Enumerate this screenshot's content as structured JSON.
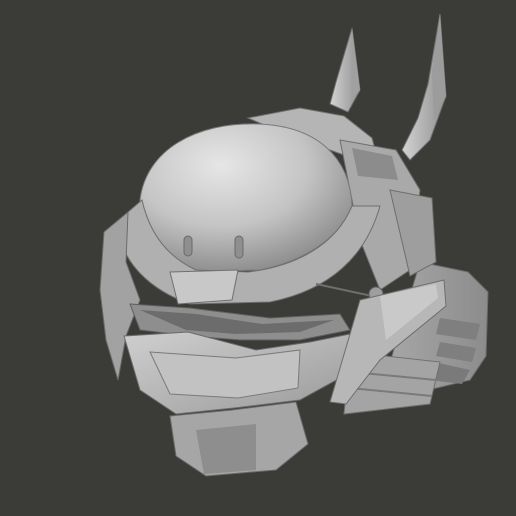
{
  "scene": {
    "background": "#3b3b37",
    "subject": "helmet-model",
    "material_color": "#b8b8b8",
    "shadow_color": "#6e6e6e",
    "highlight_color": "#e2e2e2"
  }
}
